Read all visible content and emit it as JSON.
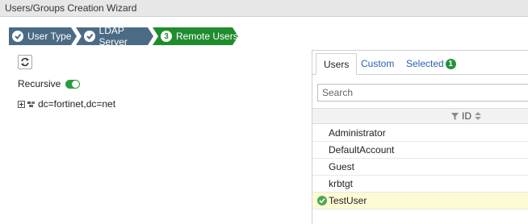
{
  "window": {
    "title": "Users/Groups Creation Wizard"
  },
  "wizard": {
    "steps": [
      {
        "label": "User Type",
        "state": "done"
      },
      {
        "label": "LDAP Server",
        "state": "done"
      },
      {
        "label": "Remote Users",
        "state": "current",
        "number": "3"
      }
    ],
    "colors": {
      "done": "#4b6b85",
      "current": "#1f8c2e"
    }
  },
  "left": {
    "refresh_icon": "refresh-icon",
    "recursive_label": "Recursive",
    "recursive_on": true,
    "tree_root": "dc=fortinet,dc=net"
  },
  "right": {
    "tabs": {
      "users": "Users",
      "custom": "Custom",
      "selected": "Selected",
      "selected_count": "1"
    },
    "search": {
      "placeholder": "Search",
      "value": ""
    },
    "columns": {
      "id": "ID"
    },
    "rows": [
      {
        "name": "Administrator",
        "selected": false
      },
      {
        "name": "DefaultAccount",
        "selected": false
      },
      {
        "name": "Guest",
        "selected": false
      },
      {
        "name": "krbtgt",
        "selected": false
      },
      {
        "name": "TestUser",
        "selected": true
      }
    ]
  }
}
